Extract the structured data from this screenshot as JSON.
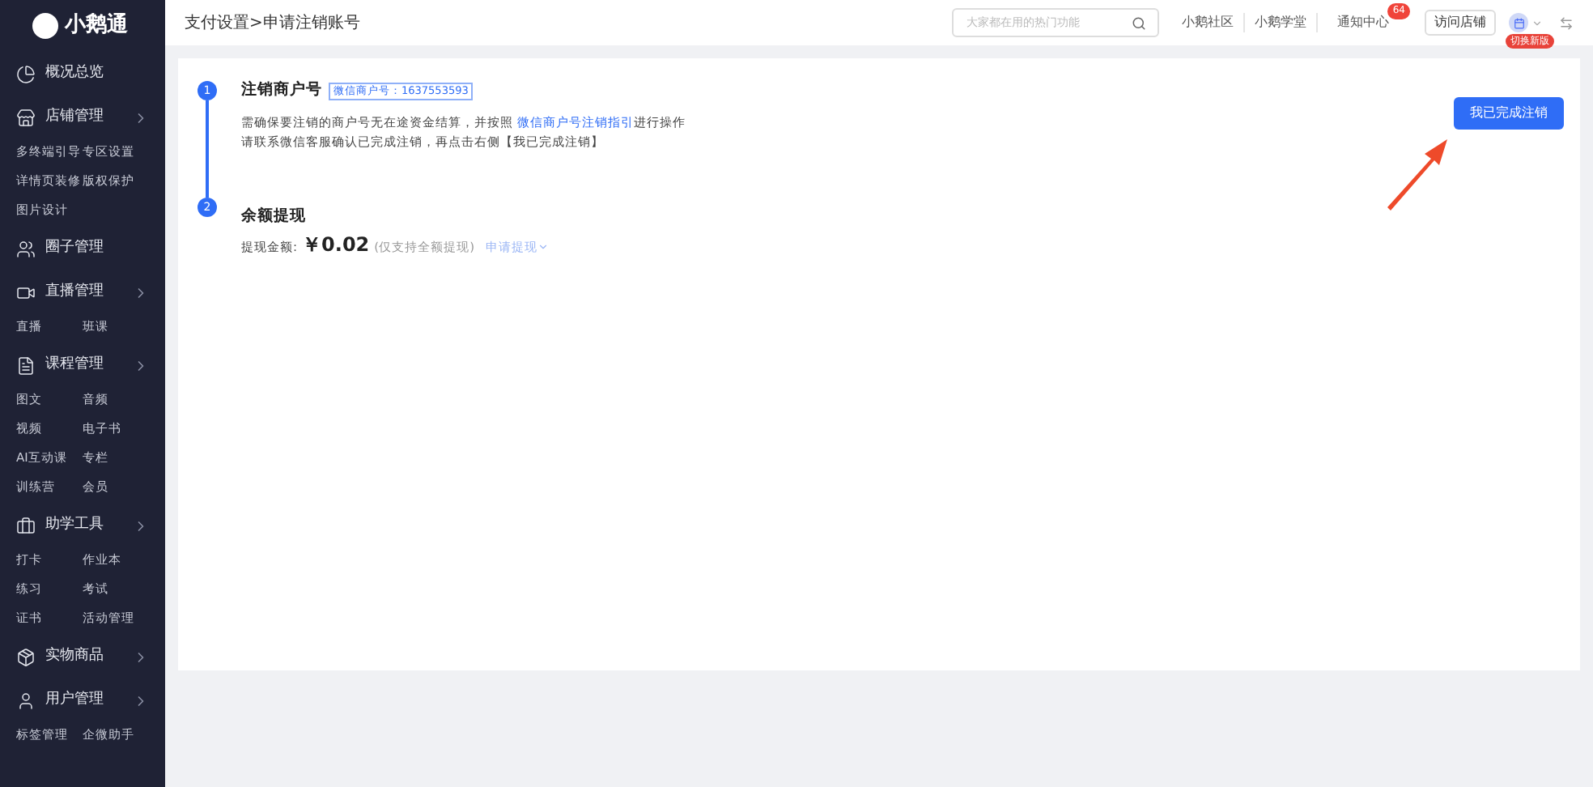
{
  "logo": {
    "name": "小鹅通"
  },
  "sidebar": [
    {
      "label": "概况总览",
      "expandable": false
    },
    {
      "label": "店铺管理",
      "expandable": true,
      "children": [
        "多终端引导",
        "专区设置",
        "详情页装修",
        "版权保护",
        "图片设计"
      ]
    },
    {
      "label": "圈子管理",
      "expandable": false
    },
    {
      "label": "直播管理",
      "expandable": true,
      "children": [
        "直播",
        "班课"
      ]
    },
    {
      "label": "课程管理",
      "expandable": true,
      "children": [
        "图文",
        "音频",
        "视频",
        "电子书",
        "AI互动课",
        "专栏",
        "训练营",
        "会员"
      ]
    },
    {
      "label": "助学工具",
      "expandable": true,
      "children": [
        "打卡",
        "作业本",
        "练习",
        "考试",
        "证书",
        "活动管理"
      ]
    },
    {
      "label": "实物商品",
      "expandable": true
    },
    {
      "label": "用户管理",
      "expandable": true,
      "children": [
        "标签管理",
        "企微助手"
      ]
    }
  ],
  "breadcrumb": "支付设置>申请注销账号",
  "topbar": {
    "search_placeholder": "大家都在用的热门功能",
    "links": [
      "小鹅社区",
      "小鹅学堂"
    ],
    "notice": "通知中心",
    "notice_badge": "64",
    "visit_button": "访问店铺",
    "switch_badge": "切换新版"
  },
  "steps": [
    {
      "number": "1",
      "title": "注销商户号",
      "tag": "微信商户号：1637553593",
      "lines": [
        {
          "before": "需确保要注销的商户号无在途资金结算，并按照 ",
          "link": "微信商户号注销指引",
          "after": "进行操作"
        },
        {
          "before": "请联系微信客服确认已完成注销，再点击右侧【我已完成注销】"
        }
      ]
    },
    {
      "number": "2",
      "title": "余额提现",
      "amount_label": "提现金额:",
      "amount": "￥0.02",
      "amount_note": "(仅支持全额提现)",
      "withdraw_link": "申请提现"
    }
  ],
  "done_button": "我已完成注销"
}
